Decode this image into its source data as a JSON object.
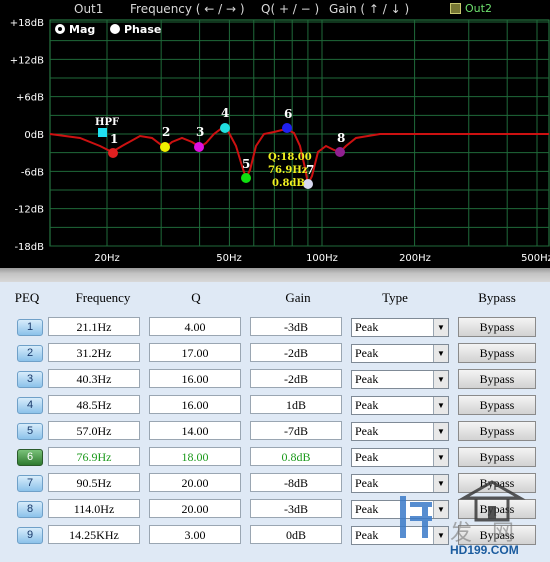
{
  "header": {
    "out1": "Out1",
    "frequency_hint": "Frequency ( ← / → )",
    "q_hint": "Q( + / − )",
    "gain_hint": "Gain ( ↑ / ↓ )",
    "out2": "Out2"
  },
  "view_mode": {
    "mag": "Mag",
    "phase": "Phase",
    "selected": "Mag"
  },
  "graph": {
    "y_labels": [
      "+18dB",
      "+12dB",
      "+6dB",
      "0dB",
      "-6dB",
      "-12dB",
      "-18dB"
    ],
    "y_values": [
      18,
      12,
      6,
      0,
      -6,
      -12,
      -18
    ],
    "x_labels": [
      "20Hz",
      "50Hz",
      "100Hz",
      "200Hz",
      "500Hz"
    ],
    "hpf_label": "HPF",
    "curve_color": "#cc1111",
    "grid_color": "#1f6a3a",
    "markers": [
      {
        "label": "1",
        "color": "#e02020"
      },
      {
        "label": "2",
        "color": "#f0f000"
      },
      {
        "label": "3",
        "color": "#e010e0"
      },
      {
        "label": "4",
        "color": "#20e0e0"
      },
      {
        "label": "5",
        "color": "#10e010"
      },
      {
        "label": "6",
        "color": "#2020f0"
      },
      {
        "label": "7",
        "color": "#d8d8f0"
      },
      {
        "label": "8",
        "color": "#902090"
      }
    ],
    "tooltip": {
      "q": "Q:18.00",
      "freq": "76.9Hz",
      "gain": "0.8dB"
    }
  },
  "table": {
    "headers": {
      "peq": "PEQ",
      "frequency": "Frequency",
      "q": "Q",
      "gain": "Gain",
      "type": "Type",
      "bypass": "Bypass"
    },
    "rows": [
      {
        "n": "1",
        "freq": "21.1Hz",
        "q": "4.00",
        "gain": "-3dB",
        "type": "Peak",
        "bypass": "Bypass"
      },
      {
        "n": "2",
        "freq": "31.2Hz",
        "q": "17.00",
        "gain": "-2dB",
        "type": "Peak",
        "bypass": "Bypass"
      },
      {
        "n": "3",
        "freq": "40.3Hz",
        "q": "16.00",
        "gain": "-2dB",
        "type": "Peak",
        "bypass": "Bypass"
      },
      {
        "n": "4",
        "freq": "48.5Hz",
        "q": "16.00",
        "gain": "1dB",
        "type": "Peak",
        "bypass": "Bypass"
      },
      {
        "n": "5",
        "freq": "57.0Hz",
        "q": "14.00",
        "gain": "-7dB",
        "type": "Peak",
        "bypass": "Bypass"
      },
      {
        "n": "6",
        "freq": "76.9Hz",
        "q": "18.00",
        "gain": "0.8dB",
        "type": "Peak",
        "bypass": "Bypass",
        "active": true
      },
      {
        "n": "7",
        "freq": "90.5Hz",
        "q": "20.00",
        "gain": "-8dB",
        "type": "Peak",
        "bypass": "Bypass"
      },
      {
        "n": "8",
        "freq": "114.0Hz",
        "q": "20.00",
        "gain": "-3dB",
        "type": "Peak",
        "bypass": "Bypass"
      },
      {
        "n": "9",
        "freq": "14.25KHz",
        "q": "3.00",
        "gain": "0dB",
        "type": "Peak",
        "bypass": "Bypass"
      }
    ]
  },
  "watermark": {
    "text": "HD199.COM"
  }
}
